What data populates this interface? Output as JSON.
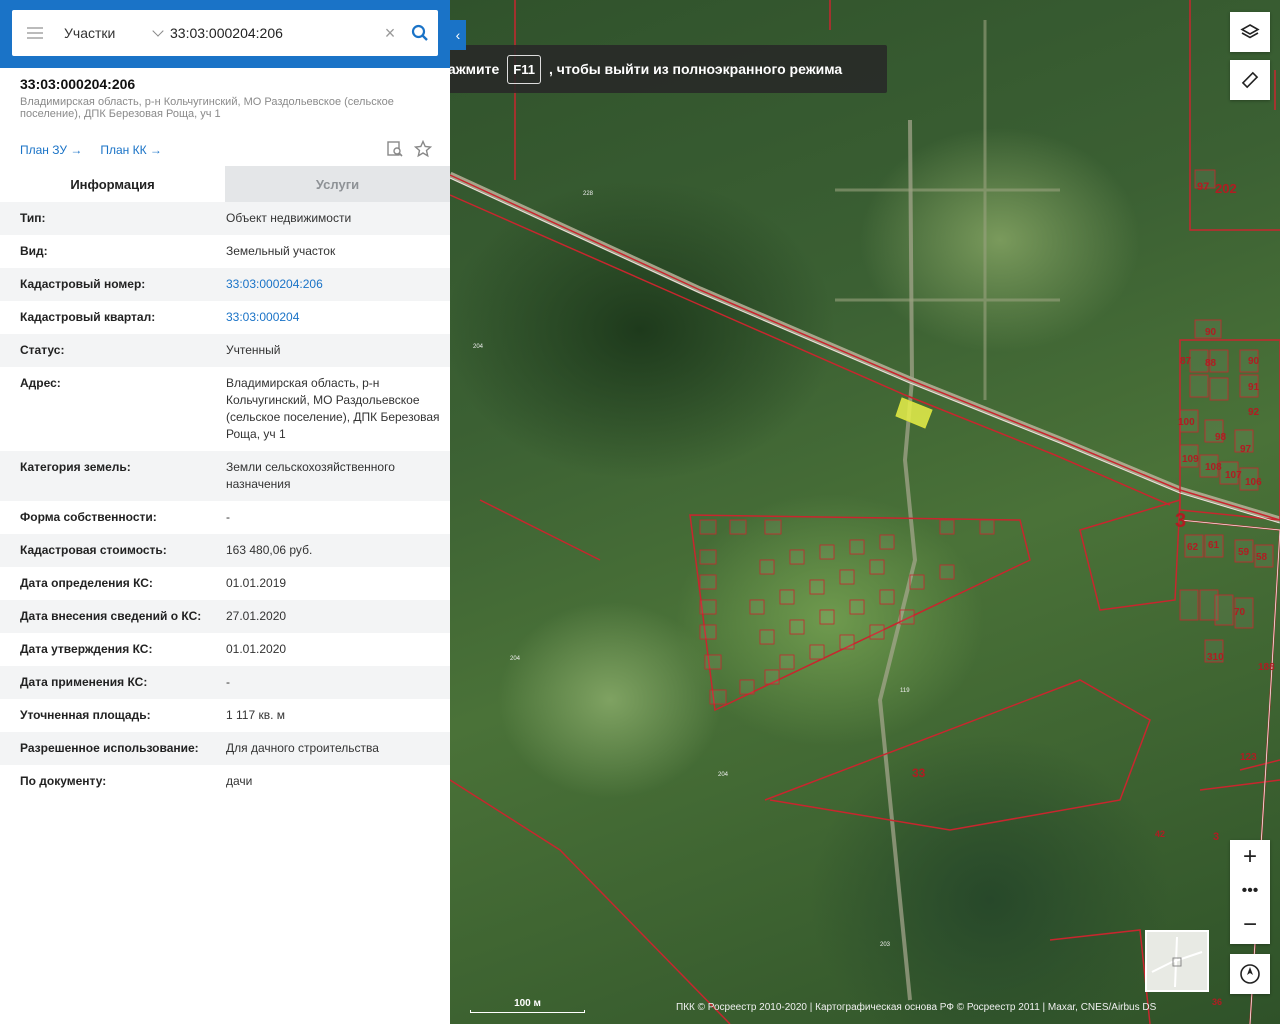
{
  "search": {
    "type_label": "Участки",
    "query": "33:03:000204:206"
  },
  "fullscreen_notice": {
    "prefix": "Нажмите",
    "key": "F11",
    "suffix": ", чтобы выйти из полноэкранного режима"
  },
  "object": {
    "title": "33:03:000204:206",
    "address": "Владимирская область, р-н Кольчугинский, МО Раздольевское (сельское поселение), ДПК Березовая Роща, уч 1",
    "plan_zu": "План ЗУ →",
    "plan_kk": "План КК →"
  },
  "tabs": {
    "info": "Информация",
    "services": "Услуги"
  },
  "info_rows": [
    {
      "label": "Тип:",
      "value": "Объект недвижимости"
    },
    {
      "label": "Вид:",
      "value": "Земельный участок"
    },
    {
      "label": "Кадастровый номер:",
      "value": "33:03:000204:206"
    },
    {
      "label": "Кадастровый квартал:",
      "value": "33:03:000204"
    },
    {
      "label": "Статус:",
      "value": "Учтенный"
    },
    {
      "label": "Адрес:",
      "value": "Владимирская область, р-н Кольчугинский, МО Раздольевское (сельское поселение), ДПК Березовая Роща, уч 1"
    },
    {
      "label": "Категория земель:",
      "value": "Земли сельскохозяйственного назначения"
    },
    {
      "label": "Форма собственности:",
      "value": "-"
    },
    {
      "label": "Кадастровая стоимость:",
      "value": "163 480,06 руб."
    },
    {
      "label": "Дата определения КС:",
      "value": "01.01.2019"
    },
    {
      "label": "Дата внесения сведений о КС:",
      "value": "27.01.2020"
    },
    {
      "label": "Дата утверждения КС:",
      "value": "01.01.2020"
    },
    {
      "label": "Дата применения КС:",
      "value": "-"
    },
    {
      "label": "Уточненная площадь:",
      "value": "1 117 кв. м"
    },
    {
      "label": "Разрешенное использование:",
      "value": "Для дачного строительства"
    },
    {
      "label": "По документу:",
      "value": "дачи"
    }
  ],
  "map": {
    "parcel_labels": [
      "97",
      "202",
      "90",
      "87",
      "88",
      "90",
      "91",
      "92",
      "100",
      "98",
      "97",
      "109",
      "108",
      "107",
      "106",
      "3",
      "62",
      "61",
      "59",
      "58",
      "70",
      "310",
      "188",
      "123",
      "33",
      "3",
      "42",
      "36"
    ],
    "scale": "100 м",
    "attribution": "ПКК © Росреестр 2010-2020 | Картографическая основа РФ © Росреестр 2011 | Maxar, CNES/Airbus DS",
    "highlight_color": "#e6f04a",
    "boundary_color": "#c8262e"
  },
  "colors": {
    "accent": "#1a73c7"
  }
}
